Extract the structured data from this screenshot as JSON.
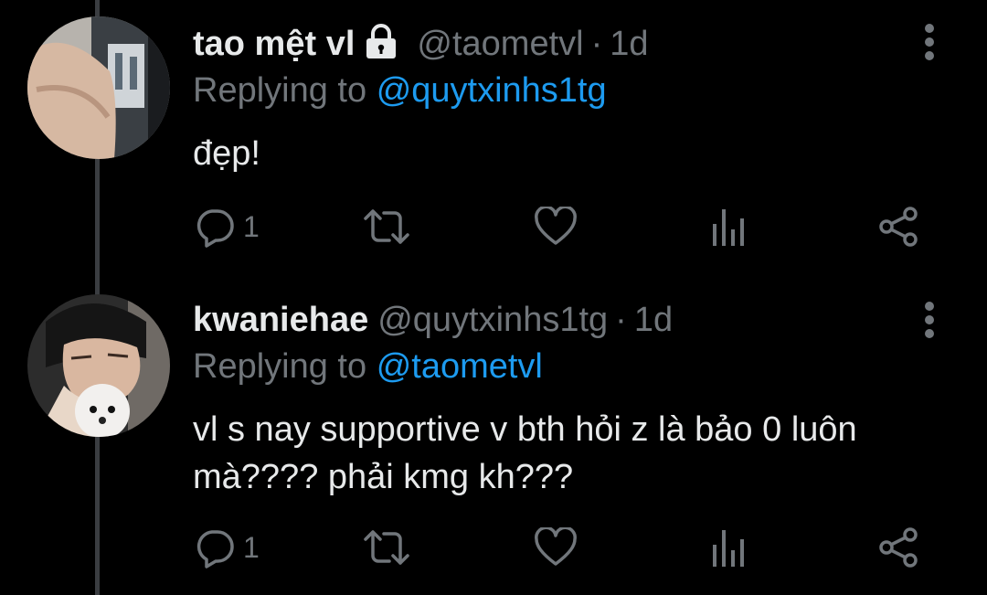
{
  "tweets": [
    {
      "display_name": "tao mệt vl",
      "protected": true,
      "handle": "@taometvl",
      "separator": "·",
      "time": "1d",
      "replying_prefix": "Replying to",
      "replying_to": "@quytxinhs1tg",
      "text": "đẹp!",
      "reply_count": "1"
    },
    {
      "display_name": "kwaniehae",
      "protected": false,
      "handle": "@quytxinhs1tg",
      "separator": "·",
      "time": "1d",
      "replying_prefix": "Replying to",
      "replying_to": "@taometvl",
      "text": "vl s nay supportive v bth hỏi z là bảo 0 luôn mà???? phải kmg kh???",
      "reply_count": "1"
    }
  ],
  "colors": {
    "background": "#000000",
    "primary_text": "#e7e9ea",
    "secondary_text": "#71767b",
    "link": "#1d9bf0",
    "thread_line": "#3a3d41"
  },
  "icons": [
    "lock-icon",
    "reply-icon",
    "retweet-icon",
    "like-icon",
    "analytics-icon",
    "share-icon",
    "more-icon"
  ]
}
